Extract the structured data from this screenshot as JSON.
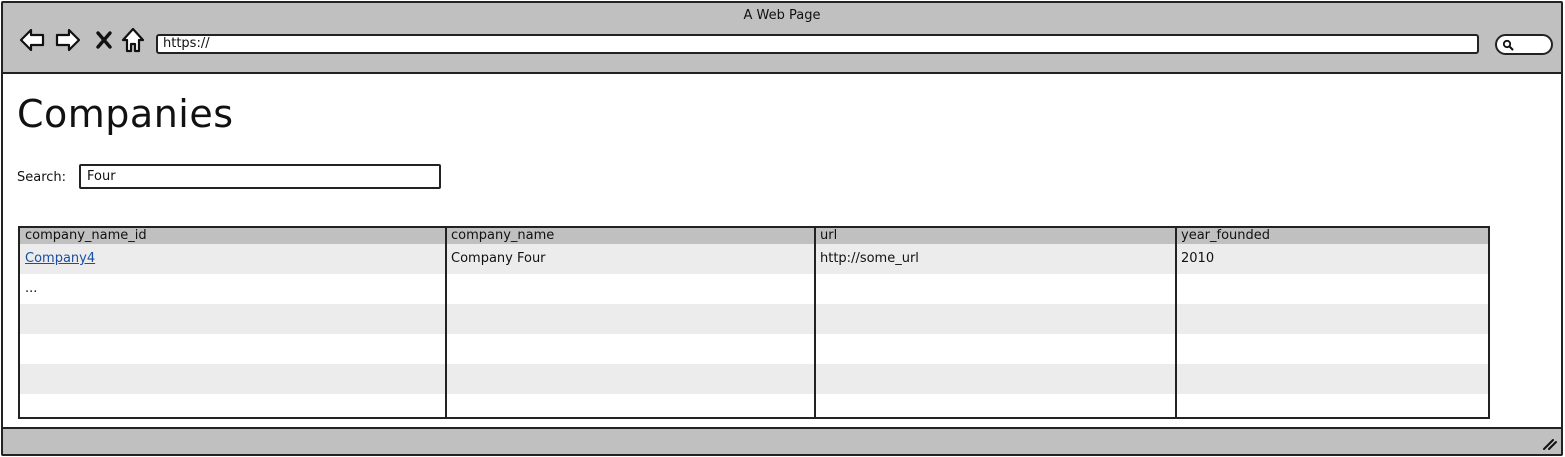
{
  "window": {
    "title": "A Web Page"
  },
  "browser": {
    "url": "https://",
    "icons": [
      "back-arrow-icon",
      "forward-arrow-icon",
      "close-x-icon",
      "home-icon",
      "search-icon"
    ]
  },
  "page": {
    "title": "Companies",
    "search": {
      "label": "Search:",
      "value": "Four"
    }
  },
  "table": {
    "columns": [
      "company_name_id",
      "company_name",
      "url",
      "year_founded"
    ],
    "rows": [
      [
        "Company4",
        "Company Four",
        "http://some_url",
        "2010"
      ],
      [
        "...",
        "",
        "",
        ""
      ]
    ]
  },
  "colors": {
    "chrome": "#c0c0c0",
    "row_alt": "#ececec",
    "link": "#1a4fa0",
    "border": "#222222"
  }
}
